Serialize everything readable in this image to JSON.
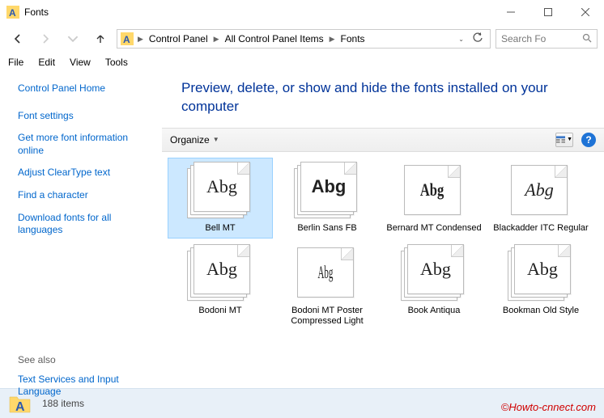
{
  "window": {
    "title": "Fonts"
  },
  "breadcrumbs": [
    "Control Panel",
    "All Control Panel Items",
    "Fonts"
  ],
  "search": {
    "placeholder": "Search Fo"
  },
  "menus": [
    "File",
    "Edit",
    "View",
    "Tools"
  ],
  "sidebar": {
    "home": "Control Panel Home",
    "links": [
      "Font settings",
      "Get more font information online",
      "Adjust ClearType text",
      "Find a character",
      "Download fonts for all languages"
    ]
  },
  "seealso": {
    "header": "See also",
    "links": [
      "Text Services and Input Language"
    ]
  },
  "page": {
    "title": "Preview, delete, or show and hide the fonts installed on your computer",
    "organize": "Organize"
  },
  "fonts": [
    {
      "name": "Bell MT",
      "sample": "Abg",
      "family": "serif",
      "style": "",
      "stack": true,
      "selected": true
    },
    {
      "name": "Berlin Sans FB",
      "sample": "Abg",
      "family": "sans-serif",
      "style": "font-weight:600",
      "stack": true,
      "selected": false
    },
    {
      "name": "Bernard MT Condensed",
      "sample": "Abg",
      "family": "serif",
      "style": "font-weight:900;transform:scaleX(0.75)",
      "stack": false,
      "selected": false
    },
    {
      "name": "Blackadder ITC Regular",
      "sample": "Abg",
      "family": "cursive",
      "style": "font-style:italic;font-family:'Brush Script MT',cursive",
      "stack": false,
      "selected": false
    },
    {
      "name": "Bodoni MT",
      "sample": "Abg",
      "family": "serif",
      "style": "font-family:'Bodoni MT','Didot',serif",
      "stack": true,
      "selected": false
    },
    {
      "name": "Bodoni MT Poster Compressed Light",
      "sample": "Abg",
      "family": "serif",
      "style": "transform:scaleX(0.5);font-weight:300",
      "stack": false,
      "selected": false
    },
    {
      "name": "Book Antiqua",
      "sample": "Abg",
      "family": "serif",
      "style": "font-family:'Book Antiqua','Palatino',serif",
      "stack": true,
      "selected": false
    },
    {
      "name": "Bookman Old Style",
      "sample": "Abg",
      "family": "serif",
      "style": "font-family:'Bookman Old Style',serif",
      "stack": true,
      "selected": false
    }
  ],
  "status": {
    "count": "188 items"
  },
  "watermark": "©Howto-cnnect.com"
}
